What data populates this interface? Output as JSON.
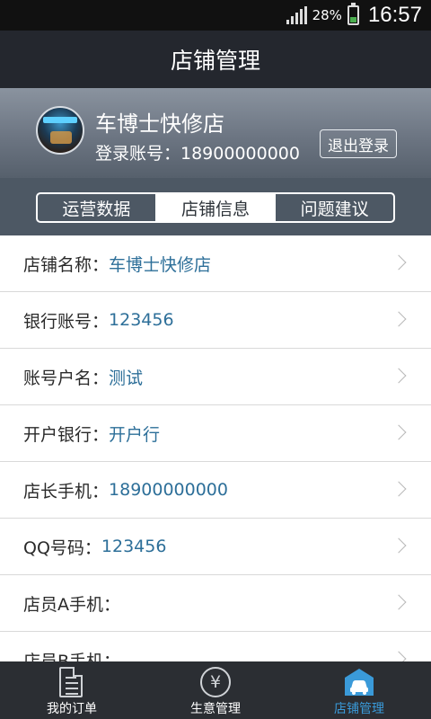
{
  "status_bar": {
    "battery": "28%",
    "time": "16:57"
  },
  "title": "店铺管理",
  "profile": {
    "shop_name": "车博士快修店",
    "login_account": "登录账号：18900000000",
    "logout_label": "退出登录"
  },
  "tabs": [
    {
      "label": "运营数据"
    },
    {
      "label": "店铺信息"
    },
    {
      "label": "问题建议"
    }
  ],
  "info_rows": [
    {
      "label": "店铺名称：",
      "value": "车博士快修店"
    },
    {
      "label": "银行账号：",
      "value": "123456"
    },
    {
      "label": "账号户名：",
      "value": "测试"
    },
    {
      "label": "开户银行：",
      "value": "开户行"
    },
    {
      "label": "店长手机：",
      "value": "18900000000"
    },
    {
      "label": "QQ号码：",
      "value": "123456"
    },
    {
      "label": "店员A手机：",
      "value": ""
    },
    {
      "label": "店员B手机：",
      "value": ""
    }
  ],
  "bottom_nav": [
    {
      "label": "我的订单",
      "icon": "document-icon"
    },
    {
      "label": "生意管理",
      "icon": "yen-icon"
    },
    {
      "label": "店铺管理",
      "icon": "shop-car-icon"
    }
  ],
  "colors": {
    "accent": "#3a9ad9",
    "value_text": "#2d6f99",
    "title_bar": "#24272e"
  }
}
